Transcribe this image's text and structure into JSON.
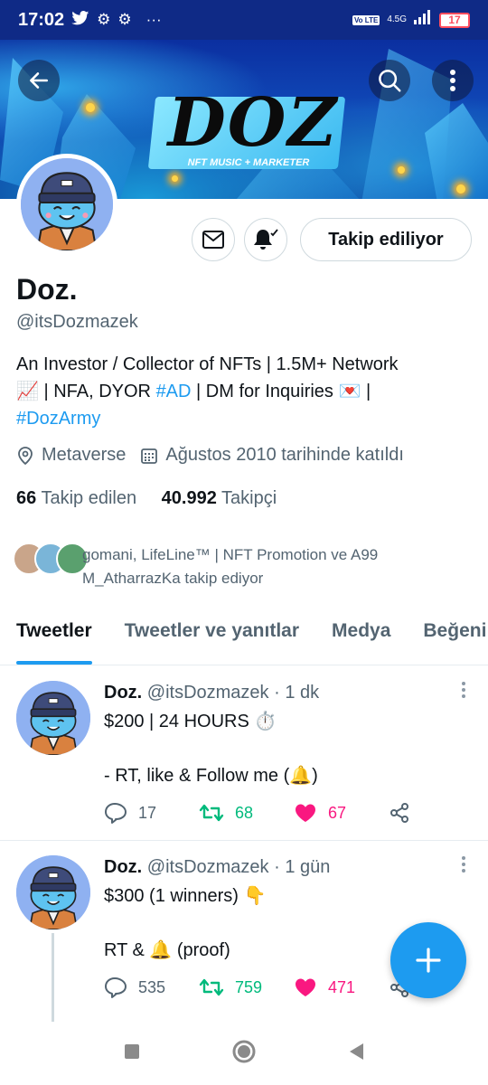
{
  "status_bar": {
    "time": "17:02",
    "network_badge": "Vo LTE",
    "network_type": "4.5G",
    "battery": "17",
    "icons": [
      "twitter-icon",
      "gear-icon",
      "gear-icon",
      "more-dots-icon",
      "signal-icon",
      "battery-icon"
    ]
  },
  "banner": {
    "logo_text": "DOZ",
    "logo_subtitle": "NFT MUSIC + MARKETER"
  },
  "profile": {
    "name": "Doz.",
    "handle": "@itsDozmazek",
    "bio_part1": "An Investor / Collector of NFTs | 1.5M+ Network",
    "bio_part2": "📈 | NFA, DYOR ",
    "bio_link1": "#AD",
    "bio_part3": " | DM for Inquiries 💌 |",
    "bio_link2": "#DozArmy",
    "location": "Metaverse",
    "joined": "Ağustos 2010 tarihinde katıldı",
    "following_count": "66",
    "following_label": "Takip edilen",
    "followers_count": "40.992",
    "followers_label": "Takipçi",
    "followed_by": "gomani, LifeLine™ | NFT Promotion ve A99 M_AtharrazKa takip ediyor",
    "follow_button": "Takip ediliyor"
  },
  "tabs": [
    {
      "label": "Tweetler",
      "active": true
    },
    {
      "label": "Tweetler ve yanıtlar",
      "active": false
    },
    {
      "label": "Medya",
      "active": false
    },
    {
      "label": "Beğeni",
      "active": false
    }
  ],
  "tweets": [
    {
      "name": "Doz.",
      "meta": "@itsDozmazek · 1 dk",
      "text": "$200 | 24 HOURS ⏱️\n\n- RT, like & Follow me (🔔)",
      "replies": "17",
      "retweets": "68",
      "likes": "67"
    },
    {
      "name": "Doz.",
      "meta": "@itsDozmazek · 1 gün",
      "text": "$300 (1 winners) 👇\n\nRT & 🔔 (proof)",
      "replies": "535",
      "retweets": "759",
      "likes": "471"
    }
  ],
  "colors": {
    "accent": "#1d9bf0",
    "retweet": "#00ba7c",
    "like": "#f91880",
    "status_bar": "#0f2a86"
  }
}
